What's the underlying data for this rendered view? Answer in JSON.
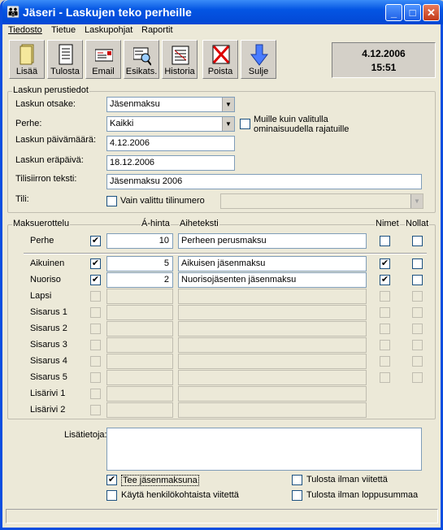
{
  "window": {
    "title": "Jäseri - Laskujen teko perheille",
    "controls": {
      "minimize": "_",
      "maximize": "□",
      "close": "✕"
    }
  },
  "menu": [
    "Tiedosto",
    "Tietue",
    "Laskupohjat",
    "Raportit"
  ],
  "toolbar": [
    "Lisää",
    "Tulosta",
    "Email",
    "Esikats.",
    "Historia",
    "Poista",
    "Sulje"
  ],
  "clock": {
    "date": "4.12.2006",
    "time": "15:51"
  },
  "basic": {
    "legend": "Laskun perustiedot",
    "otsake_label": "Laskun otsake:",
    "otsake": "Jäsenmaksu",
    "perhe_label": "Perhe:",
    "perhe": "Kaikki",
    "filter_label": "Muille kuin valitulla ominaisuudella rajatuille",
    "pvm_label": "Laskun päivämäärä:",
    "pvm": "4.12.2006",
    "era_label": "Laskun eräpäivä:",
    "era": "18.12.2006",
    "teksti_label": "Tilisiirron teksti:",
    "teksti": "Jäsenmaksu 2006",
    "tili_label": "Tili:",
    "tili_cb_label": "Vain valittu tilinumero"
  },
  "grid": {
    "legend": "Maksuerottelu",
    "col_price": "Á-hinta",
    "col_subject": "Aiheteksti",
    "col_names": "Nimet",
    "col_zero": "Nollat",
    "rows": [
      {
        "label": "Perhe",
        "checked": true,
        "price": "10",
        "text": "Perheen perusmaksu",
        "names": false,
        "zero": false
      },
      {
        "label": "Aikuinen",
        "checked": true,
        "price": "5",
        "text": "Aikuisen jäsenmaksu",
        "names": true,
        "zero": false
      },
      {
        "label": "Nuoriso",
        "checked": true,
        "price": "2",
        "text": "Nuorisojäsenten jäsenmaksu",
        "names": true,
        "zero": false
      },
      {
        "label": "Lapsi",
        "checked": false,
        "price": "",
        "text": "",
        "names": false,
        "zero": false
      },
      {
        "label": "Sisarus 1",
        "checked": false,
        "price": "",
        "text": "",
        "names": false,
        "zero": false
      },
      {
        "label": "Sisarus 2",
        "checked": false,
        "price": "",
        "text": "",
        "names": false,
        "zero": false
      },
      {
        "label": "Sisarus 3",
        "checked": false,
        "price": "",
        "text": "",
        "names": false,
        "zero": false
      },
      {
        "label": "Sisarus 4",
        "checked": false,
        "price": "",
        "text": "",
        "names": false,
        "zero": false
      },
      {
        "label": "Sisarus 5",
        "checked": false,
        "price": "",
        "text": "",
        "names": false,
        "zero": false
      },
      {
        "label": "Lisärivi 1",
        "checked": false,
        "price": "",
        "text": "",
        "names": null,
        "zero": null
      },
      {
        "label": "Lisärivi 2",
        "checked": false,
        "price": "",
        "text": "",
        "names": null,
        "zero": null
      }
    ]
  },
  "extra": {
    "label": "Lisätietoja:",
    "value": ""
  },
  "options": [
    {
      "label": "Tee jäsenmaksuna",
      "checked": true
    },
    {
      "label": "Käytä henkilökohtaista viitettä",
      "checked": false
    },
    {
      "label": "Tulosta ilman viitettä",
      "checked": false
    },
    {
      "label": "Tulosta ilman loppusummaa",
      "checked": false
    }
  ],
  "icons": [
    "book-icon",
    "document-icon",
    "envelope-icon",
    "magnifier-icon",
    "history-icon",
    "delete-x-icon",
    "exit-arrow-icon"
  ]
}
